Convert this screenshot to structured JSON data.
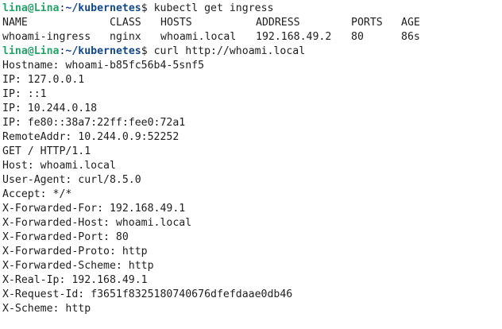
{
  "prompt": {
    "user_host": "lina@Lina",
    "separator": ":",
    "path": "~/kubernetes",
    "dollar": "$"
  },
  "commands": {
    "first": " kubectl get ingress",
    "second": " curl http://whoami.local"
  },
  "ingress_table": {
    "headers": [
      "NAME",
      "CLASS",
      "HOSTS",
      "ADDRESS",
      "PORTS",
      "AGE"
    ],
    "rows": [
      [
        "whoami-ingress",
        "nginx",
        "whoami.local",
        "192.168.49.2",
        "80",
        "86s"
      ]
    ]
  },
  "curl_output": [
    "Hostname: whoami-b85fc56b4-5snf5",
    "IP: 127.0.0.1",
    "IP: ::1",
    "IP: 10.244.0.18",
    "IP: fe80::38a7:22ff:fee0:72a1",
    "RemoteAddr: 10.244.0.9:52252",
    "GET / HTTP/1.1",
    "Host: whoami.local",
    "User-Agent: curl/8.5.0",
    "Accept: */*",
    "X-Forwarded-For: 192.168.49.1",
    "X-Forwarded-Host: whoami.local",
    "X-Forwarded-Port: 80",
    "X-Forwarded-Proto: http",
    "X-Forwarded-Scheme: http",
    "X-Real-Ip: 192.168.49.1",
    "X-Request-Id: f3651f8325180740676dfefdaae0db46",
    "X-Scheme: http"
  ],
  "colors": {
    "prompt_user": "#26a269",
    "prompt_path": "#12488b",
    "text": "#1e1e1e",
    "background": "#ffffff"
  }
}
